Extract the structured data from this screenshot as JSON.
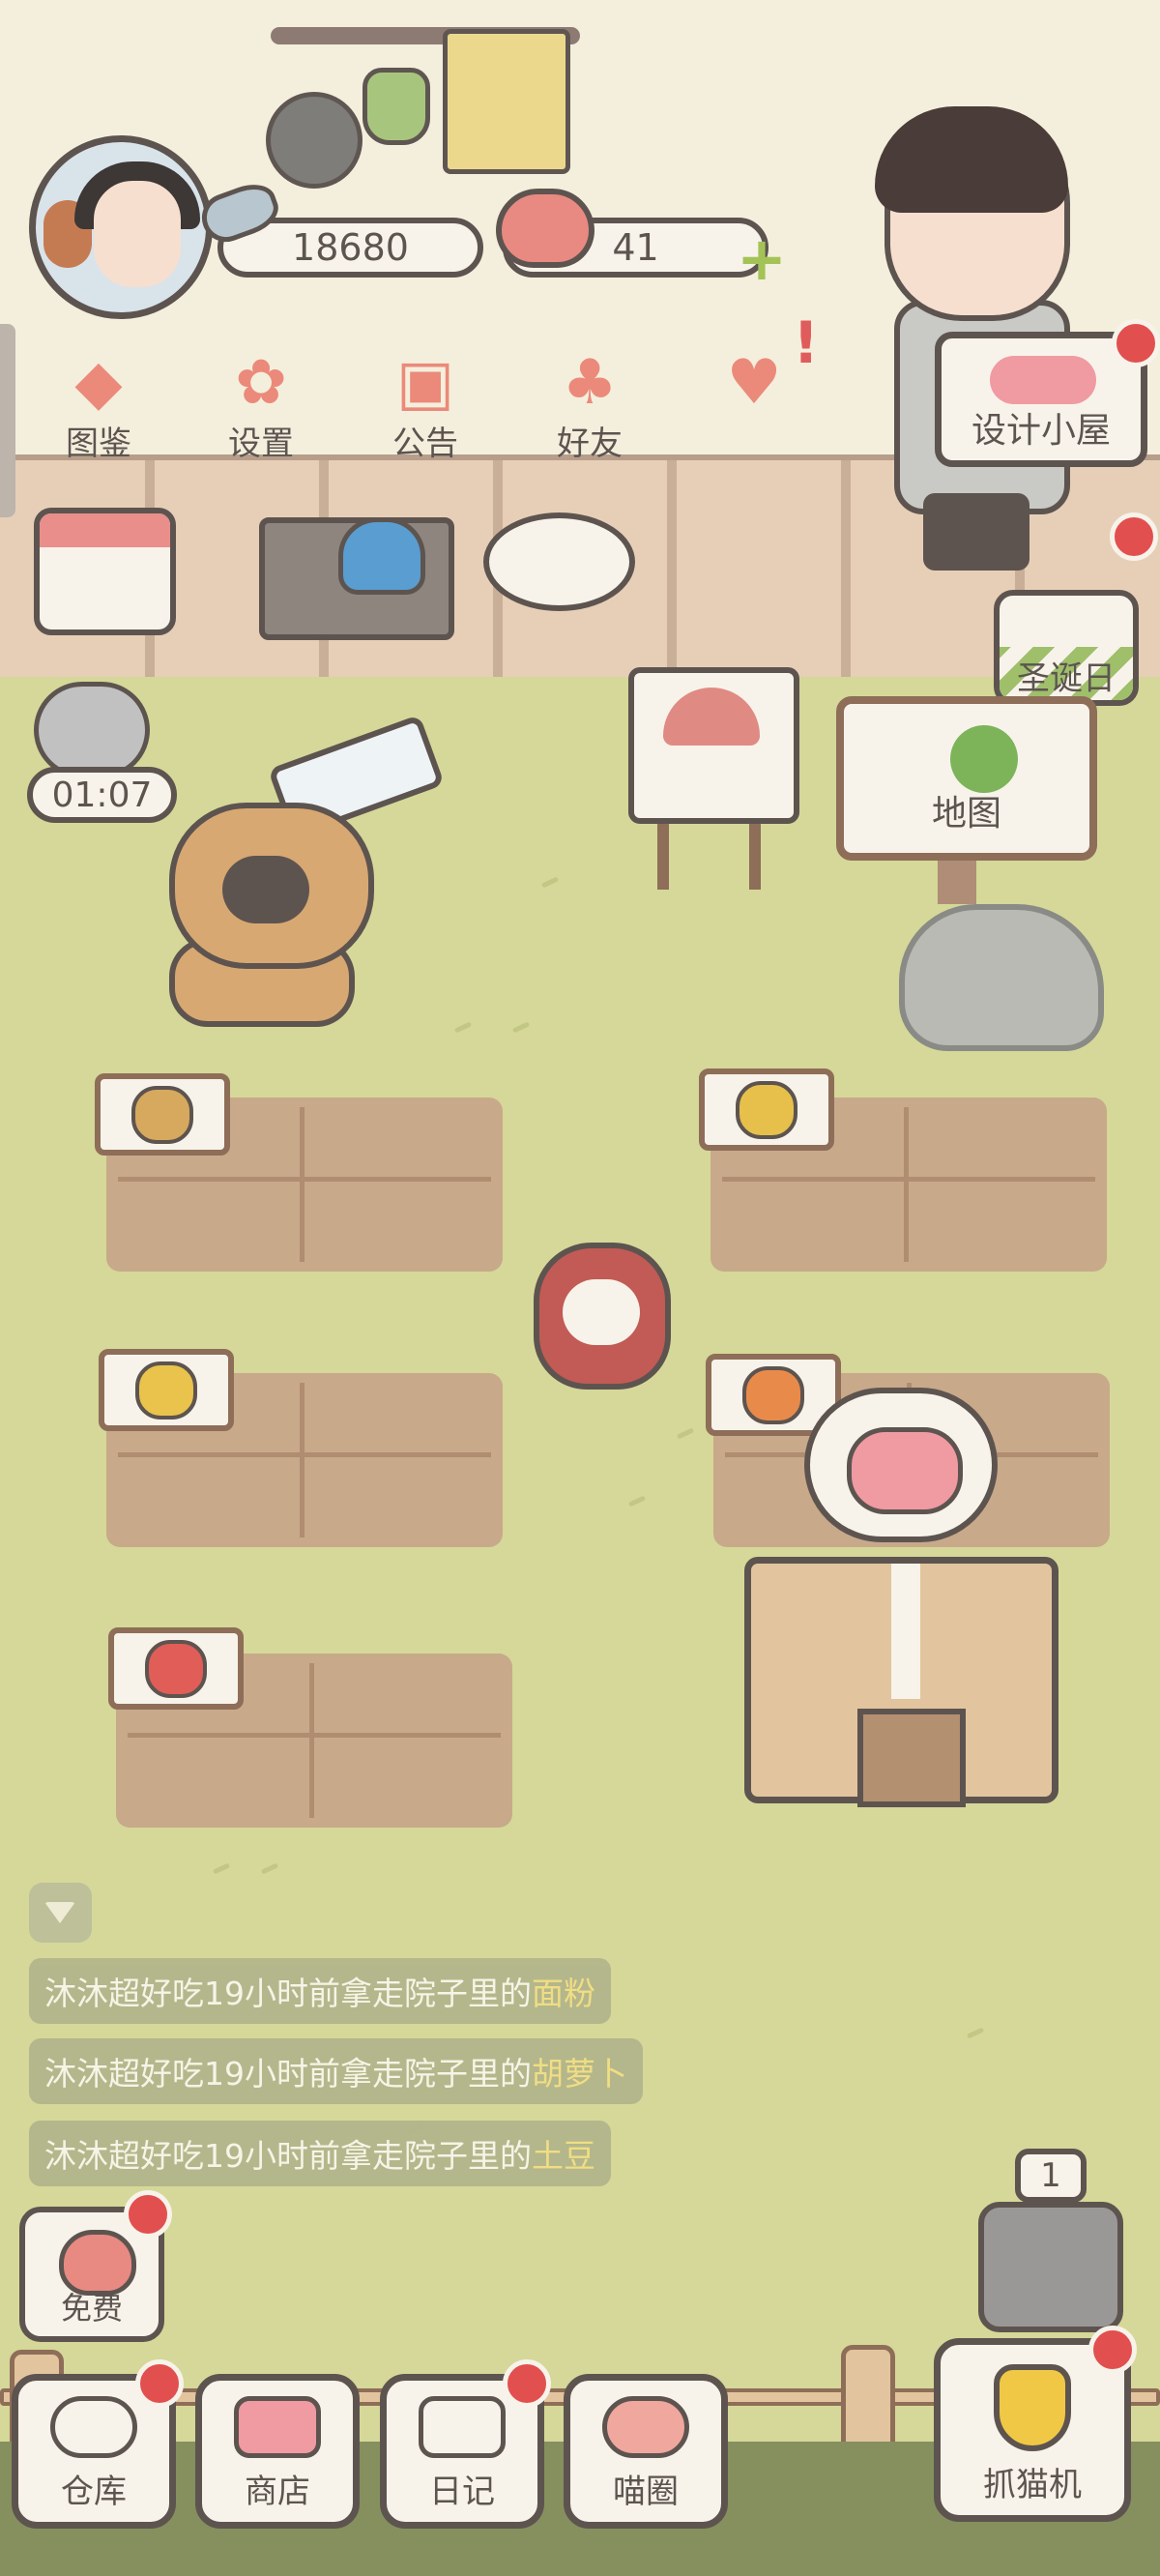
{
  "currency": {
    "fish": "18680",
    "hearts": "41"
  },
  "top_menu": [
    {
      "label": "图鉴",
      "icon": "cat-book-icon"
    },
    {
      "label": "设置",
      "icon": "gear-icon"
    },
    {
      "label": "公告",
      "icon": "gift-icon"
    },
    {
      "label": "好友",
      "icon": "friends-icon"
    }
  ],
  "right_buttons": {
    "design_house": "设计小屋",
    "christmas": "圣诞日"
  },
  "timer": "01:07",
  "map_label": "地图",
  "feed": [
    {
      "text": "沐沐超好吃19小时前拿走院子里的",
      "item": "面粉"
    },
    {
      "text": "沐沐超好吃19小时前拿走院子里的",
      "item": "胡萝卜"
    },
    {
      "text": "沐沐超好吃19小时前拿走院子里的",
      "item": "土豆"
    }
  ],
  "free_label": "免费",
  "elevator_level": "1",
  "bottom_nav": [
    {
      "label": "仓库",
      "icon": "warehouse-icon"
    },
    {
      "label": "商店",
      "icon": "shop-icon"
    },
    {
      "label": "日记",
      "icon": "diary-icon"
    },
    {
      "label": "喵圈",
      "icon": "cat-circle-icon"
    }
  ],
  "claw_label": "抓猫机",
  "colors": {
    "lawn": "#d5d898",
    "wall": "#f4efdd",
    "outline": "#5d5450",
    "badge_red": "#e24f4f",
    "feed_highlight": "#f3de83"
  }
}
